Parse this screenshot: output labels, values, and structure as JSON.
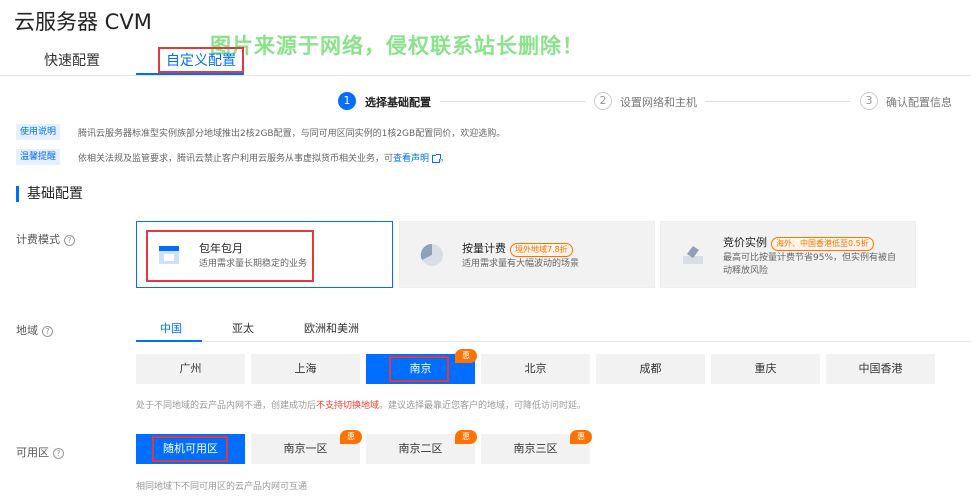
{
  "page": {
    "title": "云服务器 CVM",
    "watermark": "图片来源于网络，侵权联系站长删除！"
  },
  "tabs": [
    {
      "label": "快速配置"
    },
    {
      "label": "自定义配置"
    }
  ],
  "steps": [
    {
      "num": "1",
      "label": "选择基础配置"
    },
    {
      "num": "2",
      "label": "设置网络和主机"
    },
    {
      "num": "3",
      "label": "确认配置信息"
    }
  ],
  "notices": [
    {
      "tag": "使用说明",
      "text": "腾讯云服务器标准型实例族部分地域推出2核2GB配置，与同可用区同实例的1核2GB配置同价，欢迎选购。",
      "link": ""
    },
    {
      "tag": "温馨提醒",
      "text": "依相关法规及监管要求，腾讯云禁止客户利用云服务从事虚拟货币相关业务，可",
      "link": "查看声明"
    }
  ],
  "section": {
    "title": "基础配置"
  },
  "billing": {
    "label": "计费模式",
    "help": "?",
    "cards": [
      {
        "title": "包年包月",
        "badge": "",
        "desc": "适用需求量长期稳定的业务"
      },
      {
        "title": "按量计费",
        "badge": "境外地域7.8折",
        "desc": "适用需求量有大幅波动的场景"
      },
      {
        "title": "竞价实例",
        "badge": "海外、中国香港低至0.5折",
        "desc": "最高可比按量计费节省95%，但实例有被自动释放风险"
      }
    ]
  },
  "region": {
    "label": "地域",
    "help": "?",
    "tabs": [
      "中国",
      "亚太",
      "欧洲和美洲"
    ],
    "cities": [
      "广州",
      "上海",
      "南京",
      "北京",
      "成都",
      "重庆",
      "中国香港"
    ],
    "badge": "惠",
    "hint_prefix": "处于不同地域的云产品内网不通，创建成功后",
    "hint_warn": "不支持切换地域",
    "hint_suffix": "。建议选择最靠近您客户的地域，可降低访问时延。"
  },
  "zone": {
    "label": "可用区",
    "help": "?",
    "options": [
      "随机可用区",
      "南京一区",
      "南京二区",
      "南京三区"
    ],
    "badge": "惠",
    "hint": "相同地域下不同可用区的云产品内网可互通"
  },
  "colors": {
    "accent": "#006eff",
    "badge": "#ff7200",
    "highlight": "#e0393e",
    "watermark": "#7ee07e"
  }
}
